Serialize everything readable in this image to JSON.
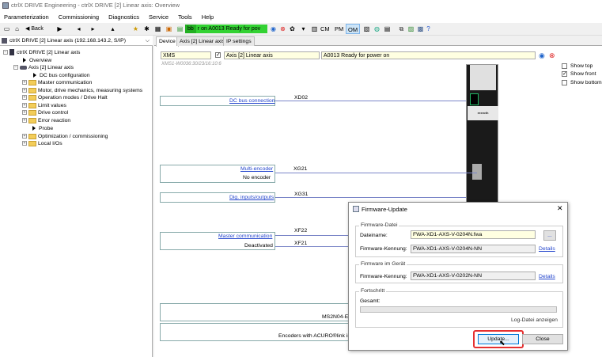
{
  "window": {
    "title": "ctrlX DRIVE Engineering - ctrlX DRIVE [2] Linear axis: Overview"
  },
  "menu": [
    "Parameterization",
    "Commissioning",
    "Diagnostics",
    "Service",
    "Tools",
    "Help"
  ],
  "toolbar": {
    "back_label": "Back",
    "status_bb": "bb",
    "status_text": "r on A0013 Ready for pov",
    "mode_cm": "CM",
    "mode_pm": "PM",
    "mode_om": "OM"
  },
  "left": {
    "drive_selector": "ctrlX DRIVE [2] Linear axis (192.168.143.2, S/IP)",
    "tree": [
      {
        "label": "ctrlX DRIVE [2] Linear axis"
      },
      {
        "label": "Overview"
      },
      {
        "label": "Axis [2] Linear axis"
      },
      {
        "label": "DC bus configuration"
      },
      {
        "label": "Master communication"
      },
      {
        "label": "Motor, drive mechanics, measuring systems"
      },
      {
        "label": "Operation modes / Drive Halt"
      },
      {
        "label": "Limit values"
      },
      {
        "label": "Drive control"
      },
      {
        "label": "Error reaction"
      },
      {
        "label": "Probe"
      },
      {
        "label": "Optimization / commissioning"
      },
      {
        "label": "Local I/Os"
      }
    ]
  },
  "tabs": [
    "Device",
    "Axis [2] Linear axis",
    "IP settings"
  ],
  "overview": {
    "device_type": "XMS",
    "axis_name": "Axis [2] Linear axis",
    "status_message": "A0013 Ready for power on",
    "firmware_info": "XMS1-W0036:30/23/16:10:6",
    "show_top": "Show top",
    "show_front": "Show front",
    "show_bottom": "Show bottom",
    "brand": "rexroth",
    "connections": {
      "dc_bus": {
        "link": "DC bus connection",
        "port": "XD02"
      },
      "encoder": {
        "link": "Multi-encoder",
        "status": "No encoder",
        "port": "XG21"
      },
      "digital_io": {
        "link": "Dig. inputs/outputs",
        "port": "XG31"
      },
      "master_comm": {
        "link": "Master communication",
        "status": "Deactivated",
        "port1": "XF22",
        "port2": "XF21"
      }
    },
    "motor_label": "MS2N04-E",
    "encoder_label": "Encoders with ACURO®link int"
  },
  "dialog": {
    "title": "Firmware-Update",
    "group_file": "Firmware-Datei",
    "file_name_label": "Dateiname:",
    "file_name_value": "FWA-XD1-AXS-V-0204N.fwa",
    "browse_label": "...",
    "id_label": "Firmware-Kennung:",
    "file_id_value": "FWA-XD1-AXS-V-0204N-NN",
    "details_label": "Details",
    "group_device": "Firmware im Gerät",
    "device_id_value": "FWA-XD1-AXS-V-0202N-NN",
    "group_progress": "Fortschritt",
    "total_label": "Gesamt:",
    "progress": 0,
    "log_link": "Log-Datei anzeigen",
    "update_button": "Update...",
    "close_button": "Close"
  }
}
